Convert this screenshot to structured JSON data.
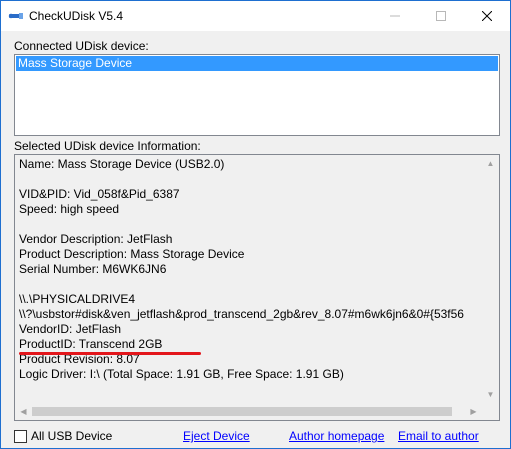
{
  "window": {
    "title": "CheckUDisk V5.4",
    "icon": "usb-icon",
    "controls": {
      "minimize": "–",
      "maximize": "☐",
      "close": "✕"
    }
  },
  "connected": {
    "label": "Connected UDisk device:",
    "items": [
      "Mass Storage Device"
    ],
    "selected_index": 0
  },
  "selected_info": {
    "label": "Selected UDisk device Information:",
    "lines": [
      "Name: Mass Storage Device  (USB2.0)",
      "",
      "VID&PID: Vid_058f&Pid_6387",
      "Speed: high speed",
      "",
      "Vendor Description: JetFlash",
      "Product Description: Mass Storage Device",
      "Serial Number: M6WK6JN6",
      "",
      "\\\\.\\PHYSICALDRIVE4",
      "\\\\?\\usbstor#disk&ven_jetflash&prod_transcend_2gb&rev_8.07#m6wk6jn6&0#{53f56",
      "VendorID: JetFlash",
      "ProductID: Transcend 2GB",
      "Product Revision: 8.07",
      "Logic Driver: I:\\  (Total Space: 1.91 GB, Free Space: 1.91 GB)"
    ]
  },
  "footer": {
    "all_usb_label": "All USB Device",
    "all_usb_checked": false,
    "eject_label": "Eject Device",
    "author_home_label": "Author homepage",
    "email_label": "Email to author"
  },
  "colors": {
    "selection": "#3399ff",
    "link": "#0000ff",
    "annotation": "#e3161b"
  }
}
